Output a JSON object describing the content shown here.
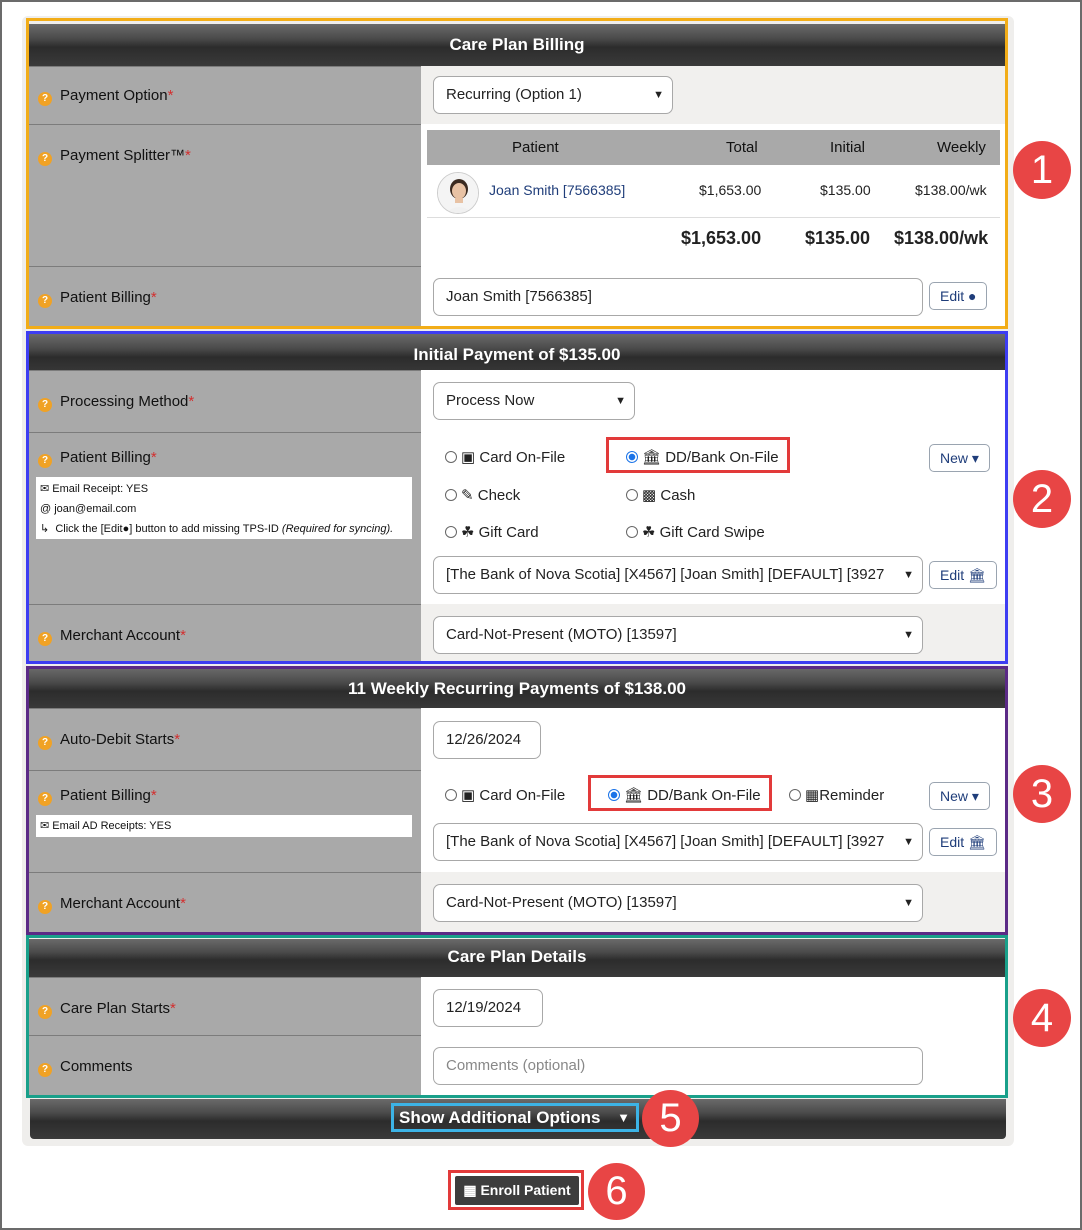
{
  "care_plan_billing": {
    "title": "Care Plan Billing",
    "payment_option": {
      "label": "Payment Option",
      "value": "Recurring (Option 1)"
    },
    "payment_splitter": {
      "label": "Payment Splitter™",
      "columns": [
        "Patient",
        "Total",
        "Initial",
        "Weekly"
      ],
      "row": {
        "patient": "Joan Smith [7566385]",
        "total": "$1,653.00",
        "initial": "$135.00",
        "weekly": "$138.00/wk"
      },
      "totals": {
        "total": "$1,653.00",
        "initial": "$135.00",
        "weekly": "$138.00/wk"
      }
    },
    "patient_billing": {
      "label": "Patient Billing",
      "value": "Joan Smith [7566385]",
      "edit_label": "Edit"
    }
  },
  "initial_payment": {
    "title": "Initial Payment of $135.00",
    "processing_method": {
      "label": "Processing Method",
      "value": "Process Now"
    },
    "patient_billing": {
      "label": "Patient Billing",
      "notes": [
        "Email Receipt: YES",
        "joan@email.com"
      ],
      "hint_prefix": "Click the [Edit",
      "hint_mid": "] button to add missing TPS-ID",
      "hint_em": "(Required for syncing).",
      "options": [
        "Card On-File",
        "DD/Bank On-File",
        "Check",
        "Cash",
        "Gift Card",
        "Gift Card Swipe"
      ],
      "selected": "DD/Bank On-File",
      "new_label": "New",
      "account": "[The Bank of Nova Scotia] [X4567] [Joan Smith] [DEFAULT] [3927",
      "edit_label": "Edit"
    },
    "merchant_account": {
      "label": "Merchant Account",
      "value": "Card-Not-Present (MOTO) [13597]"
    }
  },
  "recurring": {
    "title": "11 Weekly Recurring Payments of $138.00",
    "auto_debit": {
      "label": "Auto-Debit Starts",
      "value": "12/26/2024"
    },
    "patient_billing": {
      "label": "Patient Billing",
      "note": "Email AD Receipts: YES",
      "options": [
        "Card On-File",
        "DD/Bank On-File",
        "Reminder"
      ],
      "selected": "DD/Bank On-File",
      "new_label": "New",
      "account": "[The Bank of Nova Scotia] [X4567] [Joan Smith] [DEFAULT] [3927",
      "edit_label": "Edit"
    },
    "merchant_account": {
      "label": "Merchant Account",
      "value": "Card-Not-Present (MOTO) [13597]"
    }
  },
  "details": {
    "title": "Care Plan Details",
    "care_plan_starts": {
      "label": "Care Plan Starts",
      "value": "12/19/2024"
    },
    "comments": {
      "label": "Comments",
      "placeholder": "Comments (optional)"
    }
  },
  "additional_options_label": "Show Additional Options",
  "enroll_label": "Enroll Patient",
  "callouts": [
    "1",
    "2",
    "3",
    "4",
    "5",
    "6"
  ],
  "colors": {
    "section1": "#f2ad18",
    "section2": "#3d3df2",
    "section3": "#5b2a86",
    "section4": "#19a08a",
    "callout": "#e84545",
    "highlight": "#e23a3a",
    "link": "#1f3d7a"
  }
}
